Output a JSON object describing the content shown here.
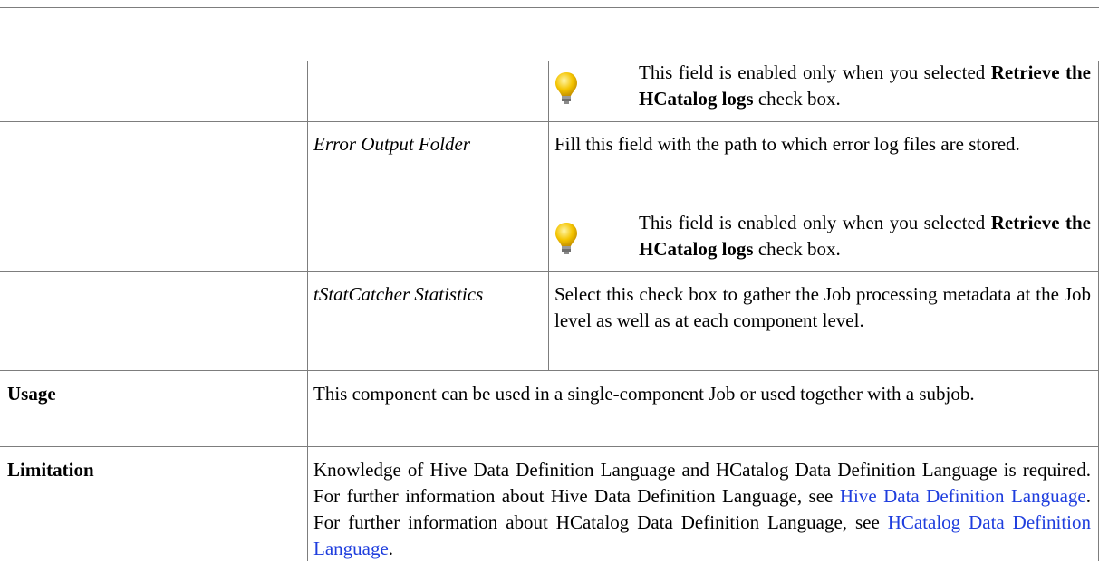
{
  "continued_row": {
    "note": {
      "text_before": "This field is enabled only when you selected",
      "bold": "Retrieve the HCatalog logs",
      "text_after": " check box.",
      "icon": "lightbulb-tip-icon"
    }
  },
  "error_output_row": {
    "label": "Error Output Folder",
    "description": "Fill this field with the path to which error log files are stored.",
    "note": {
      "text_before": "This field is enabled only when you selected",
      "bold": "Retrieve the HCatalog logs",
      "text_after": " check box.",
      "icon": "lightbulb-tip-icon"
    }
  },
  "stat_catcher_row": {
    "label": "tStatCatcher Statistics",
    "description": "Select this check box to gather the Job processing metadata at the Job level as well as at each component level."
  },
  "usage_row": {
    "header": "Usage",
    "description": "This component can be used in a single-component Job or used together with a subjob."
  },
  "limitation_row": {
    "header": "Limitation",
    "text_1": "Knowledge of Hive Data Definition Language and HCatalog Data Definition Language is required. For further information about Hive Data Definition Language, see ",
    "link_1": "Hive Data Definition Language",
    "text_2": ". For further information about HCatalog Data Definition Language, see ",
    "link_2": "HCatalog Data Definition Language",
    "text_3": "."
  },
  "colors": {
    "border": "#7d7d7d",
    "link": "#1f3ede"
  }
}
